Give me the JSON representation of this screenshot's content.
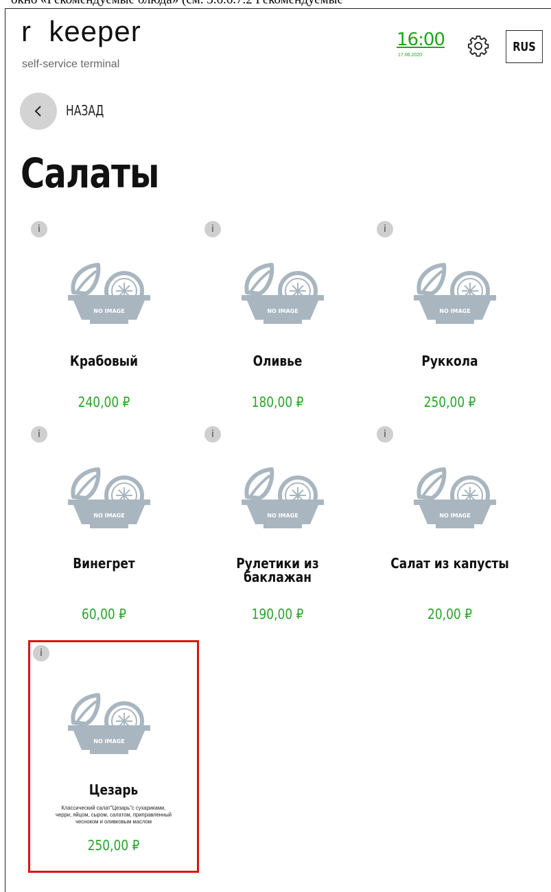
{
  "caption": "окно «Рекомендуемые блюда» (см. 3.6.6.7.2 Рекомендуемые",
  "header": {
    "logo_main": "r  keeper",
    "logo_sub": "self-service terminal",
    "time": "16:00",
    "date": "17.06.2020",
    "settings_icon": "gear-icon",
    "language": "RUS"
  },
  "nav": {
    "back_icon": "chevron-left-icon",
    "back_label": "НАЗАД"
  },
  "page_title": "Салаты",
  "colors": {
    "price": "#2aa22a",
    "clock": "#1aa81a",
    "selection": "#e01010"
  },
  "items": [
    {
      "name": "Крабовый",
      "price": "240,00 ₽",
      "image": "NO IMAGE"
    },
    {
      "name": "Оливье",
      "price": "180,00 ₽",
      "image": "NO IMAGE"
    },
    {
      "name": "Руккола",
      "price": "250,00 ₽",
      "image": "NO IMAGE"
    },
    {
      "name": "Винегрет",
      "price": "60,00 ₽",
      "image": "NO IMAGE"
    },
    {
      "name": "Рулетики из баклажан",
      "name_line1": "Рулетики из",
      "name_line2": "баклажан",
      "price": "190,00 ₽",
      "image": "NO IMAGE"
    },
    {
      "name": "Салат из капусты",
      "price": "20,00 ₽",
      "image": "NO IMAGE"
    },
    {
      "name": "Цезарь",
      "description_lines": [
        "Классический салат\"Цезарь\"с сухариками,",
        "черри, яйцом, сыром, салатом, приправленный",
        "чесноком и оливковым маслом"
      ],
      "price": "250,00 ₽",
      "image": "NO IMAGE",
      "selected": true
    }
  ]
}
